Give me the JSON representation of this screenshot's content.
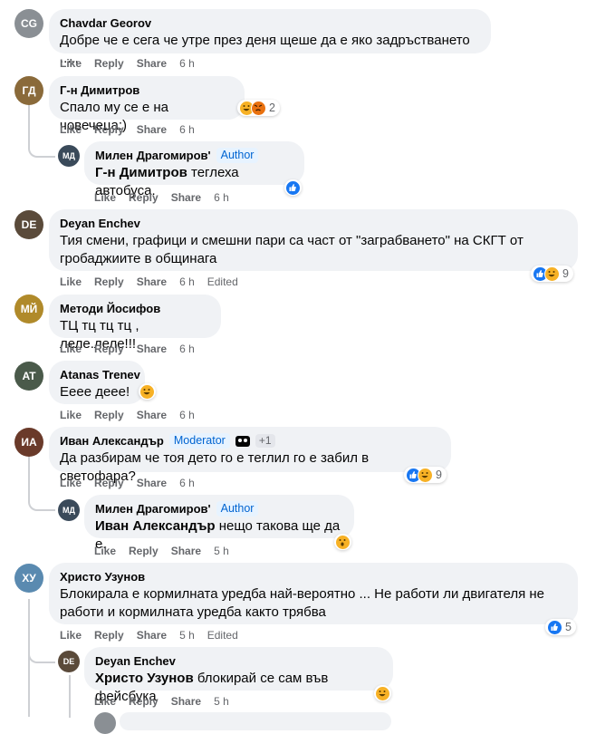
{
  "actions": {
    "like": "Like",
    "reply": "Reply",
    "share": "Share"
  },
  "comments": [
    {
      "name": "Chavdar Georov",
      "text": "Добре че е сега че утре през деня щеше да е яко задръстването .....",
      "time": "6 h"
    },
    {
      "name": "Г-н Димитров",
      "text": "Спало му се е на човечеца:)",
      "time": "6 h",
      "reactions": {
        "icons": [
          "haha-icon",
          "angry-icon"
        ],
        "count": "2"
      }
    },
    {
      "name": "Милен Драгомиров'",
      "badge": "Author",
      "mention": "Г-н Димитров",
      "text": " теглеха автобуса.",
      "time": "6 h",
      "reactions": {
        "icons": [
          "like-icon"
        ],
        "count": ""
      }
    },
    {
      "name": "Deyan Enchev",
      "text": "Тия смени, графици и смешни пари са част от \"заграбването\" на СКГТ от гробаджиите в общинага",
      "time": "6 h",
      "edited": "Edited",
      "reactions": {
        "icons": [
          "like-icon",
          "haha-icon"
        ],
        "count": "9"
      }
    },
    {
      "name": "Методи Йосифов",
      "text": "ТЦ тц тц тц , леле.леле!!!",
      "time": "6 h"
    },
    {
      "name": "Atanas Trenev",
      "text": "Еееe деее!",
      "time": "6 h",
      "reactions": {
        "icons": [
          "haha-icon"
        ],
        "count": ""
      }
    },
    {
      "name": "Иван Александър",
      "badge": "Moderator",
      "extra": "+1",
      "text": "Да разбирам че тоя дето го е теглил го е забил в светофара?",
      "time": "6 h",
      "reactions": {
        "icons": [
          "like-icon",
          "haha-icon"
        ],
        "count": "9"
      }
    },
    {
      "name": "Милен Драгомиров'",
      "badge": "Author",
      "mention": "Иван Александър",
      "text": " нещо такова ще да е.",
      "time": "5 h",
      "reactions": {
        "icons": [
          "wow-icon"
        ],
        "count": ""
      }
    },
    {
      "name": "Христо Узунов",
      "text": "Блокирала е кормилната уредба най-вероятно ... Не работи ли двигателя не работи и кормилната уредба както трябва",
      "time": "5 h",
      "edited": "Edited",
      "reactions": {
        "icons": [
          "like-icon"
        ],
        "count": "5"
      }
    },
    {
      "name": "Deyan Enchev",
      "mention": "Христо Узунов",
      "text": " блокирай се сам във фейсбука",
      "time": "5 h",
      "reactions": {
        "icons": [
          "haha-icon"
        ],
        "count": ""
      }
    }
  ],
  "colors": {
    "bubble": "#f0f2f5",
    "meta": "#65676b",
    "like": "#1877f2",
    "haha": "#f7b125",
    "badge_text": "#0064d1",
    "badge_bg": "#e7f3ff"
  }
}
